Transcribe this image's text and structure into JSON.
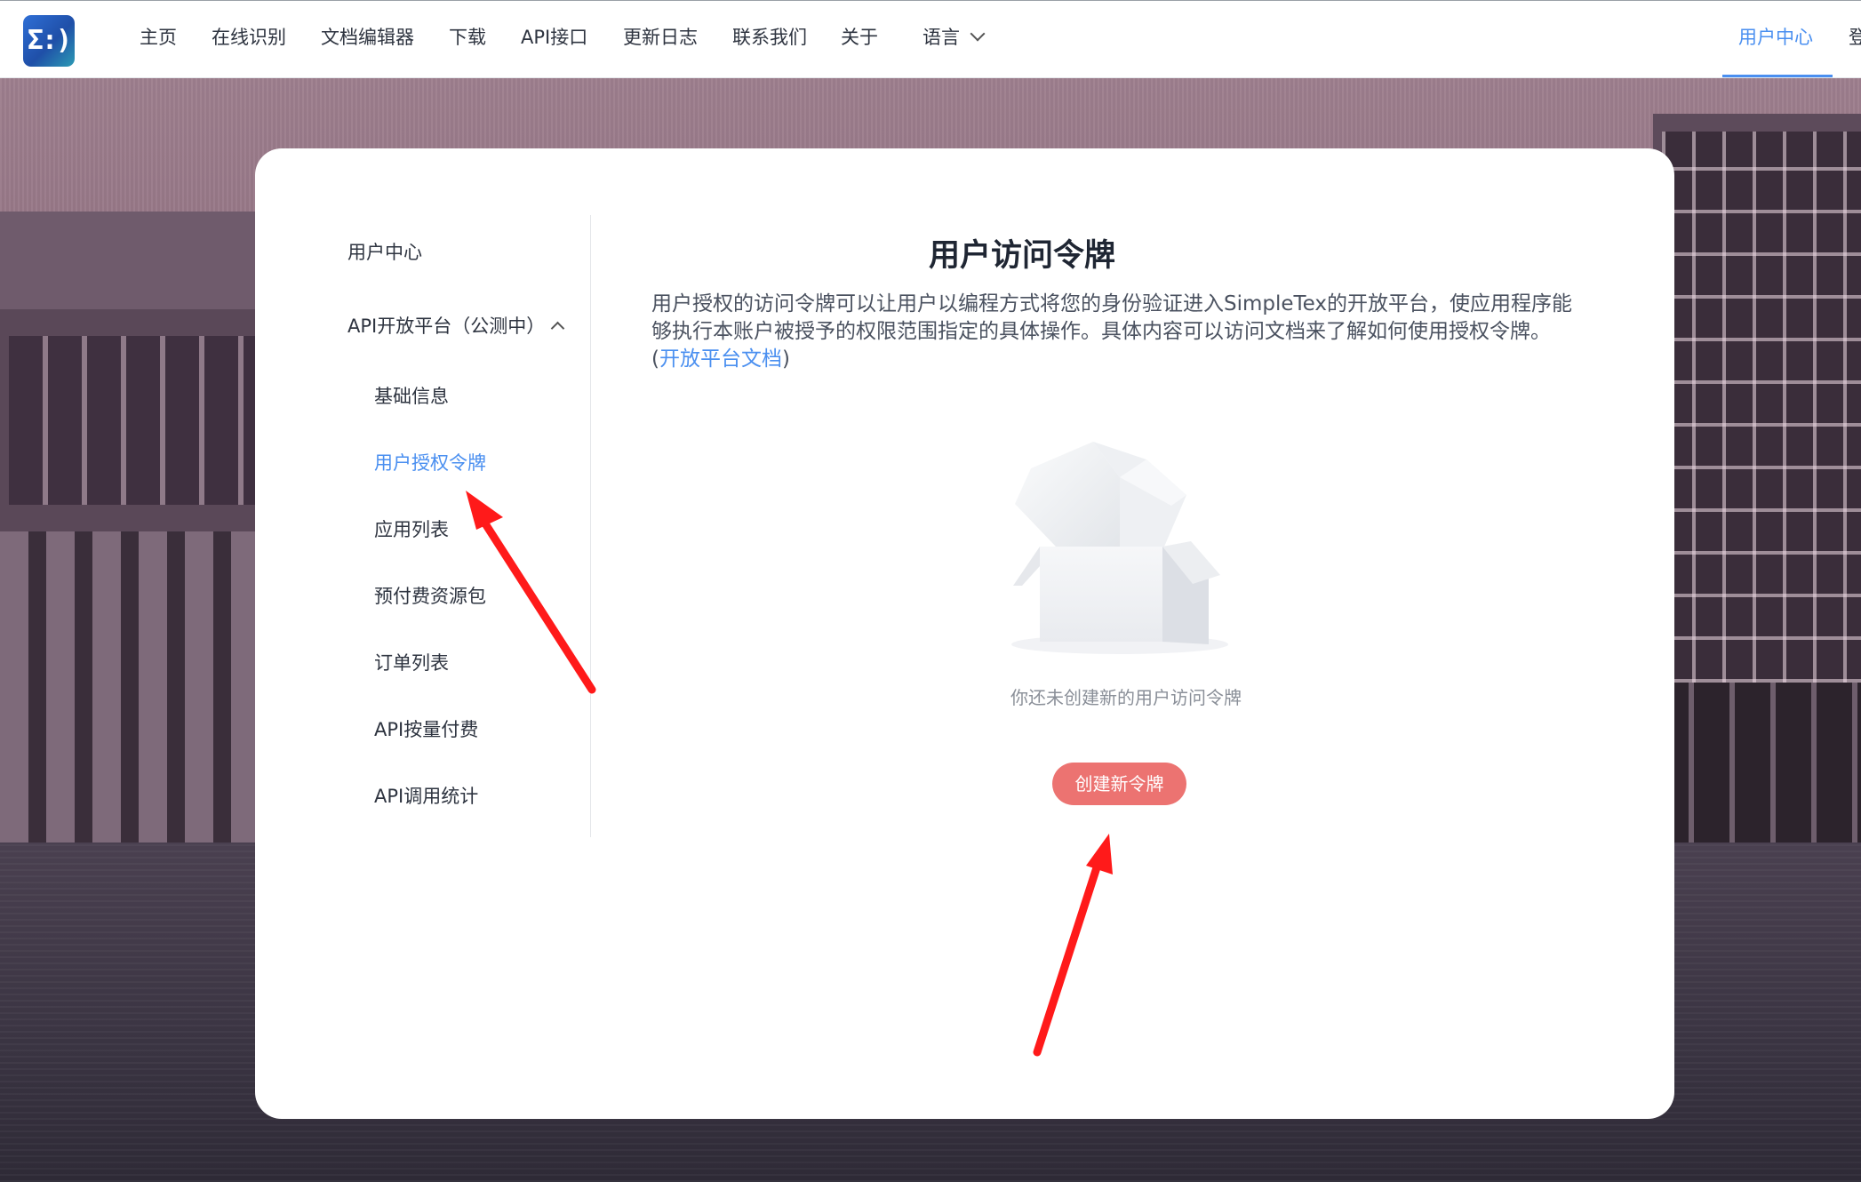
{
  "nav": {
    "logo_text": "Σ:)",
    "items": [
      "主页",
      "在线识别",
      "文档编辑器",
      "下载",
      "API接口",
      "更新日志",
      "联系我们",
      "关于"
    ],
    "language": "语言",
    "user_center": "用户中心",
    "login_partial": "登"
  },
  "sidebar": {
    "user_center": "用户中心",
    "api_platform": "API开放平台（公测中）",
    "items": [
      "基础信息",
      "用户授权令牌",
      "应用列表",
      "预付费资源包",
      "订单列表",
      "API按量付费",
      "API调用统计"
    ],
    "active": "用户授权令牌"
  },
  "content": {
    "title": "用户访问令牌",
    "description": "用户授权的访问令牌可以让用户以编程方式将您的身份验证进入SimpleTex的开放平台，使应用程序能够执行本账户被授予的权限范围指定的具体操作。具体内容可以访问文档来了解如何使用授权令牌。",
    "doc_link_open": "(",
    "doc_link": "开放平台文档",
    "doc_link_close": ")",
    "empty_text": "你还未创建新的用户访问令牌",
    "create_button": "创建新令牌"
  },
  "colors": {
    "accent_blue": "#4a8ff0",
    "button_red": "#ec7371",
    "annotation_arrow": "#ff1a1a"
  }
}
